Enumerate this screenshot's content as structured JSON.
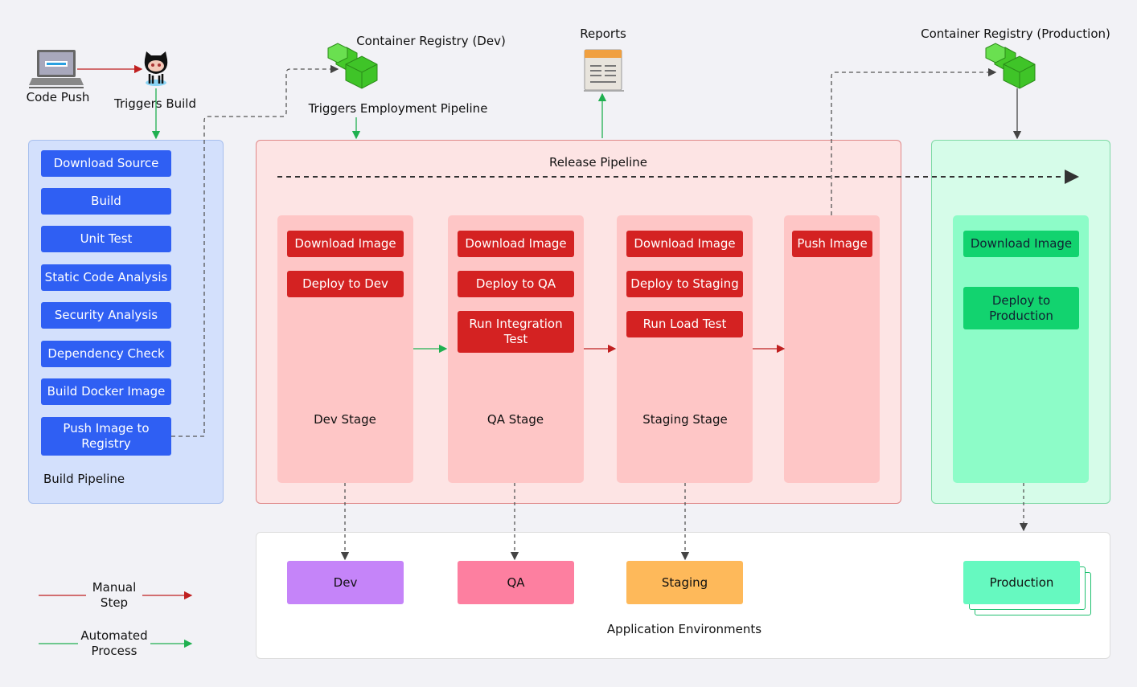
{
  "top": {
    "code_push": "Code Push",
    "triggers_build": "Triggers Build",
    "registry_dev": "Container Registry (Dev)",
    "triggers_pipeline": "Triggers Employment Pipeline",
    "reports": "Reports",
    "registry_prod": "Container Registry (Production)"
  },
  "build": {
    "title": "Build Pipeline",
    "steps": [
      "Download Source",
      "Build",
      "Unit Test",
      "Static Code Analysis",
      "Security Analysis",
      "Dependency Check",
      "Build Docker Image",
      "Push Image to Registry"
    ]
  },
  "release": {
    "title": "Release Pipeline",
    "stages": [
      {
        "name": "Dev Stage",
        "steps": [
          "Download Image",
          "Deploy to Dev"
        ]
      },
      {
        "name": "QA Stage",
        "steps": [
          "Download Image",
          "Deploy to QA",
          "Run Integration Test"
        ]
      },
      {
        "name": "Staging Stage",
        "steps": [
          "Download Image",
          "Deploy to Staging",
          "Run Load Test"
        ]
      },
      {
        "name": "",
        "steps": [
          "Push Image"
        ]
      }
    ]
  },
  "production": {
    "steps": [
      "Download Image",
      "Deploy to Production"
    ]
  },
  "environments": {
    "title": "Application Environments",
    "items": [
      "Dev",
      "QA",
      "Staging",
      "Production"
    ]
  },
  "legend": {
    "manual": "Manual Step",
    "automated": "Automated Process"
  },
  "colors": {
    "build": "#2f5ff3",
    "release": "#d42222",
    "production": "#12d36f",
    "dev": "#c584f9",
    "qa": "#fd7fa0",
    "staging": "#feb95a",
    "prod_env": "#66f9c0",
    "manual": "#c02020",
    "automated": "#20c050"
  }
}
